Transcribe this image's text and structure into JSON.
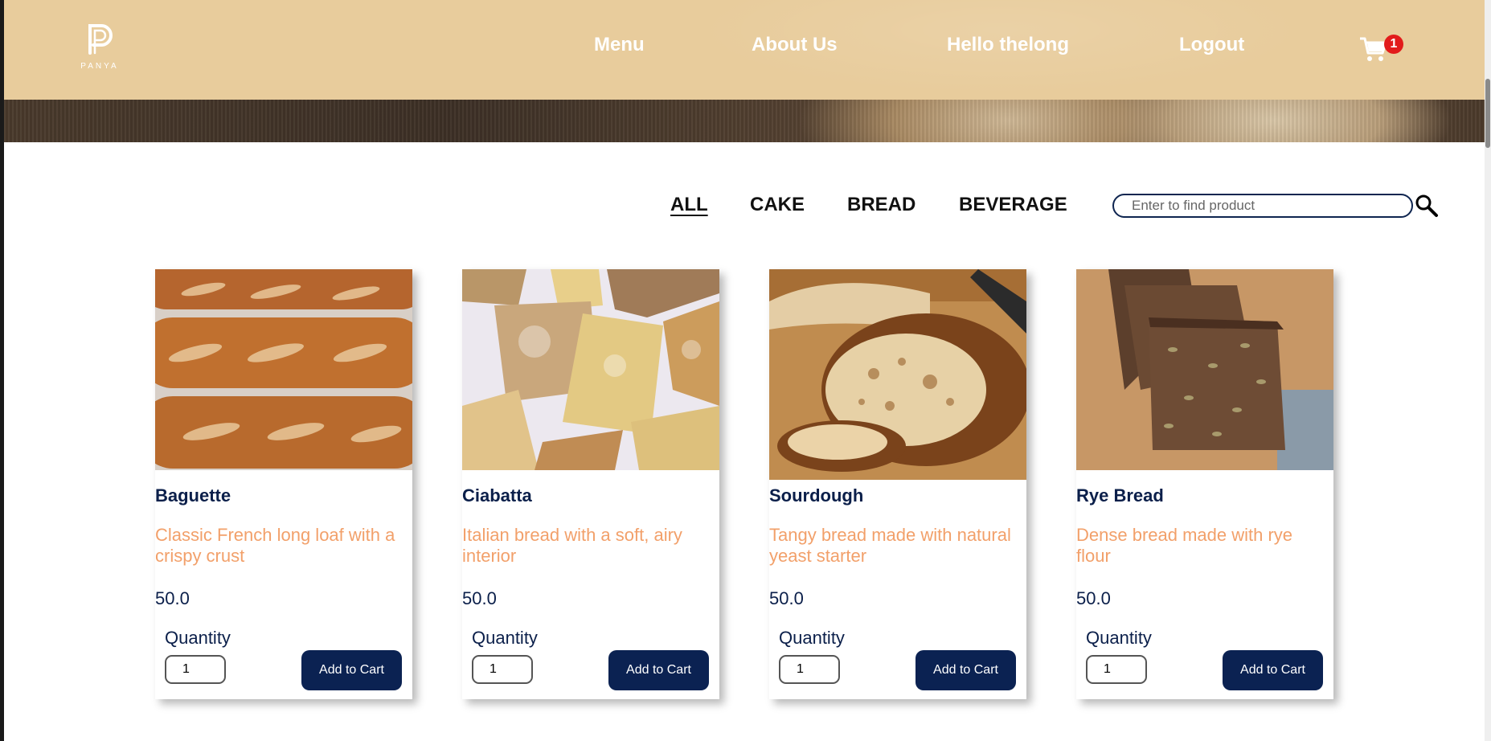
{
  "brand": {
    "logo_text": "PANYA"
  },
  "nav": {
    "menu": "Menu",
    "about": "About Us",
    "greeting": "Hello thelong",
    "logout": "Logout",
    "cart_count": "1"
  },
  "filters": {
    "all": "ALL",
    "cake": "CAKE",
    "bread": "BREAD",
    "beverage": "BEVERAGE",
    "active": "ALL"
  },
  "search": {
    "placeholder": "Enter to find product"
  },
  "products": [
    {
      "name": "Baguette",
      "description": "Classic French long loaf with a crispy crust",
      "price": "50.0",
      "quantity_label": "Quantity",
      "quantity": "1",
      "button": "Add to Cart"
    },
    {
      "name": "Ciabatta",
      "description": "Italian bread with a soft, airy interior",
      "price": "50.0",
      "quantity_label": "Quantity",
      "quantity": "1",
      "button": "Add to Cart"
    },
    {
      "name": "Sourdough",
      "description": "Tangy bread made with natural yeast starter",
      "price": "50.0",
      "quantity_label": "Quantity",
      "quantity": "1",
      "button": "Add to Cart"
    },
    {
      "name": "Rye Bread",
      "description": "Dense bread made with rye flour",
      "price": "50.0",
      "quantity_label": "Quantity",
      "quantity": "1",
      "button": "Add to Cart"
    }
  ],
  "colors": {
    "navbar": "#e8cc9c",
    "primary": "#0b2252",
    "description": "#f2a06a",
    "badge": "#e21b1b"
  }
}
